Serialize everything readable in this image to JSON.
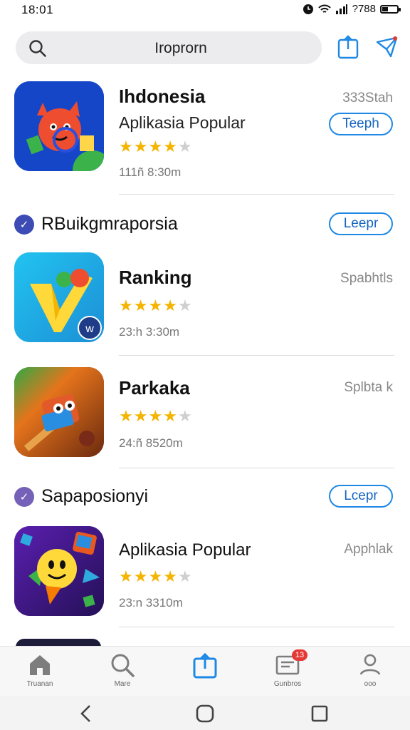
{
  "status": {
    "time": "18:01",
    "indicators": "?788"
  },
  "search": {
    "value": "Iroprorn"
  },
  "header_icons": [
    "share-icon",
    "send-icon"
  ],
  "featured": {
    "title": "Ihdonesia",
    "subtitle": "Aplikasia Popular",
    "rating": 4,
    "meta": "111ñ 8:30m",
    "side": "333Stah",
    "button": "Teeph",
    "colors": {
      "bg": "#1646c8",
      "char": "#ef4d2f"
    }
  },
  "sections": [
    {
      "title": "RBuikgmraporsia",
      "button": "Leepr",
      "badge_color": "#3d4bb4",
      "apps": [
        {
          "title": "Ranking",
          "rating": 4,
          "meta": "23:h 3:30m",
          "side": "Spabhtls"
        },
        {
          "title": "Parkaka",
          "rating": 4,
          "meta": "24:ñ 8520m",
          "side": "Splbta k"
        }
      ]
    },
    {
      "title": "Sapaposionyi",
      "button": "Lcepr",
      "badge_color": "#7561b8",
      "apps": [
        {
          "title": "Aplikasia Popular",
          "rating": 4,
          "meta": "23:n 3310m",
          "side": "Apphlak"
        }
      ]
    }
  ],
  "bottom_nav": [
    {
      "label": "Truanan",
      "icon": "home-icon"
    },
    {
      "label": "Mare",
      "icon": "search-icon"
    },
    {
      "label": "",
      "icon": "share-icon"
    },
    {
      "label": "Gunbros",
      "icon": "updates-icon",
      "badge": "13"
    },
    {
      "label": "ooo",
      "icon": "profile-icon"
    }
  ],
  "accent": "#1e88e5",
  "star_color": "#f4b400"
}
